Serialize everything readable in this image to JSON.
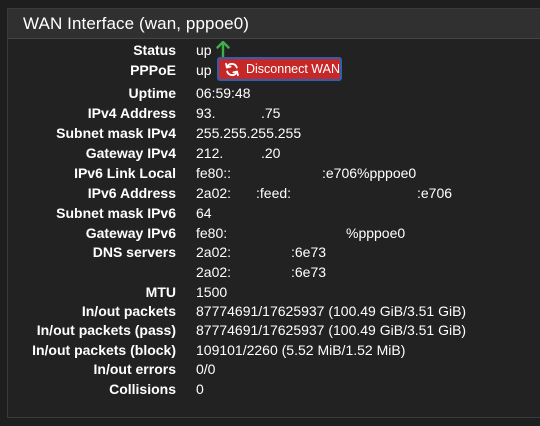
{
  "panel": {
    "title": "WAN Interface (wan, pppoe0)"
  },
  "colors": {
    "status_up": "#3fae49",
    "disconnect_button": "#c62828",
    "button_border": "#2e5fb3"
  },
  "rows": {
    "status": {
      "label": "Status",
      "value": "up",
      "icon": "up-arrow-icon"
    },
    "pppoe": {
      "label": "PPPoE",
      "value": "up",
      "button": "Disconnect WAN",
      "button_icon": "refresh-icon"
    },
    "uptime": {
      "label": "Uptime",
      "value": "06:59:48"
    },
    "ipv4": {
      "label": "IPv4 Address",
      "part1": "93.",
      "part2": ".75"
    },
    "subnet4": {
      "label": "Subnet mask IPv4",
      "value": "255.255.255.255"
    },
    "gateway4": {
      "label": "Gateway IPv4",
      "part1": "212.",
      "part2": ".20"
    },
    "linklocal6": {
      "label": "IPv6 Link Local",
      "part1": "fe80::",
      "part2": ":e706%pppoe0"
    },
    "ipv6": {
      "label": "IPv6 Address",
      "part1": "2a02:",
      "part2": ":feed:",
      "part3": ":e706"
    },
    "subnet6": {
      "label": "Subnet mask IPv6",
      "value": "64"
    },
    "gateway6": {
      "label": "Gateway IPv6",
      "part1": "fe80:",
      "part2": "%pppoe0"
    },
    "dns": {
      "label": "DNS servers",
      "line1_part1": "2a02:",
      "line1_part2": ":6e73",
      "line2_part1": "2a02:",
      "line2_part2": ":6e73"
    },
    "mtu": {
      "label": "MTU",
      "value": "1500"
    },
    "packets": {
      "label": "In/out packets",
      "value": "87774691/17625937 (100.49 GiB/3.51 GiB)"
    },
    "packets_pass": {
      "label": "In/out packets (pass)",
      "value": "87774691/17625937 (100.49 GiB/3.51 GiB)"
    },
    "packets_block": {
      "label": "In/out packets (block)",
      "value": "109101/2260 (5.52 MiB/1.52 MiB)"
    },
    "errors": {
      "label": "In/out errors",
      "value": "0/0"
    },
    "collisions": {
      "label": "Collisions",
      "value": "0"
    }
  }
}
